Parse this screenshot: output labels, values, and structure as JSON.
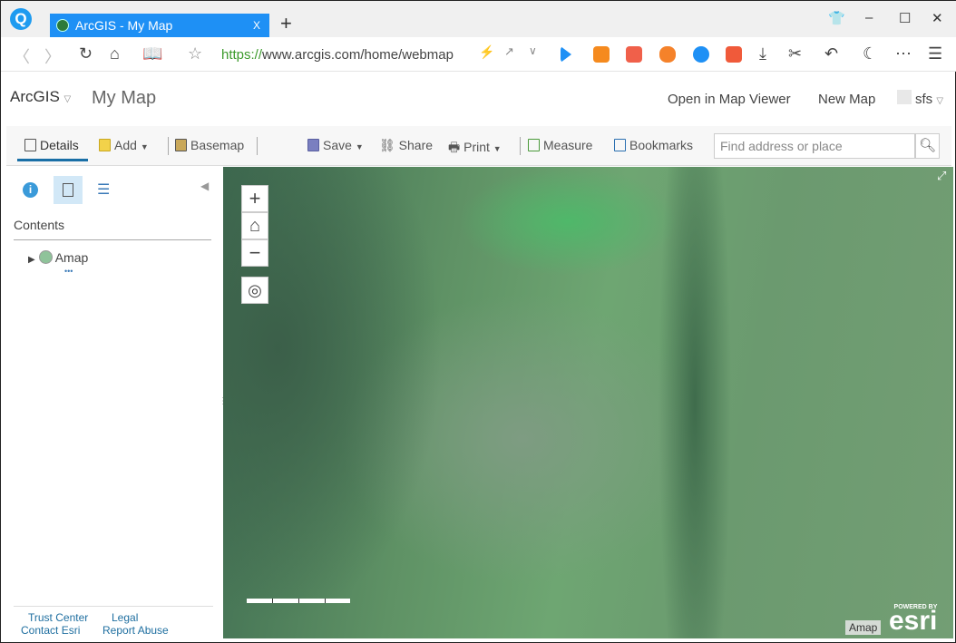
{
  "browser": {
    "tab_title": "ArcGIS - My Map",
    "tab_close": "X",
    "new_tab": "+",
    "url_scheme": "https://",
    "url_rest": "www.arcgis.com/home/webmap",
    "logo": "Q"
  },
  "header": {
    "brand": "ArcGIS",
    "map_title": "My Map",
    "open_viewer": "Open in Map Viewer",
    "new_map": "New Map",
    "user": "sfs"
  },
  "toolbar": {
    "details": "Details",
    "add": "Add",
    "basemap": "Basemap",
    "save": "Save",
    "share": "Share",
    "print": "Print",
    "measure": "Measure",
    "bookmarks": "Bookmarks",
    "search_placeholder": "Find address or place"
  },
  "sidebar": {
    "contents_label": "Contents",
    "layers": [
      {
        "name": "Amap"
      }
    ],
    "more": "•••"
  },
  "footer": {
    "links": [
      "Trust Center",
      "Legal",
      "Contact Esri",
      "Report Abuse"
    ]
  },
  "map": {
    "attribution": "Amap",
    "powered_by": "POWERED BY",
    "esri": "esri",
    "zoom_in": "+",
    "zoom_out": "−"
  }
}
